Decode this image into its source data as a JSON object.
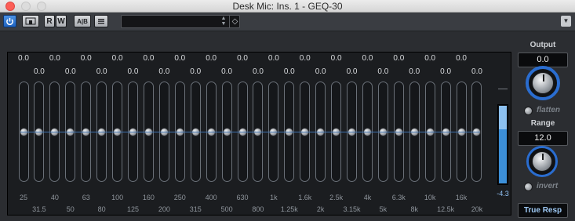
{
  "window": {
    "title": "Desk Mic: Ins. 1 - GEQ-30"
  },
  "toolbar": {
    "power_icon": "power-icon",
    "bypass_icon": "bypass-icon",
    "read_label": "R",
    "write_label": "W",
    "ab_label": "A|B",
    "list_icon": "list-icon",
    "preset_name": "",
    "preset_arrows": "▲▼",
    "preset_tag": "◇",
    "menu_icon": "▼"
  },
  "eq": {
    "band_gains": [
      "0.0",
      "0.0",
      "0.0",
      "0.0",
      "0.0",
      "0.0",
      "0.0",
      "0.0",
      "0.0",
      "0.0",
      "0.0",
      "0.0",
      "0.0",
      "0.0",
      "0.0",
      "0.0",
      "0.0",
      "0.0",
      "0.0",
      "0.0",
      "0.0",
      "0.0",
      "0.0",
      "0.0",
      "0.0",
      "0.0",
      "0.0",
      "0.0",
      "0.0",
      "0.0"
    ],
    "band_gain_values": [
      0,
      0,
      0,
      0,
      0,
      0,
      0,
      0,
      0,
      0,
      0,
      0,
      0,
      0,
      0,
      0,
      0,
      0,
      0,
      0,
      0,
      0,
      0,
      0,
      0,
      0,
      0,
      0,
      0,
      0
    ],
    "frequencies": [
      "25",
      "31.5",
      "40",
      "50",
      "63",
      "80",
      "100",
      "125",
      "160",
      "200",
      "250",
      "315",
      "400",
      "500",
      "630",
      "800",
      "1k",
      "1.25k",
      "1.6k",
      "2k",
      "2.5k",
      "3.15k",
      "4k",
      "5k",
      "6.3k",
      "8k",
      "10k",
      "12.5k",
      "16k",
      "20k"
    ]
  },
  "meter": {
    "label": "-4.3",
    "level_db": -4.3,
    "fill_fraction": 0.68
  },
  "output": {
    "title": "Output",
    "value": "0.0",
    "option": "flatten"
  },
  "range": {
    "title": "Range",
    "value": "12.0",
    "option": "invert"
  },
  "mode_button": "True Resp",
  "colors": {
    "accent": "#2a6dd0",
    "meter": "#3c8fd8",
    "close": "#fc5f57"
  }
}
